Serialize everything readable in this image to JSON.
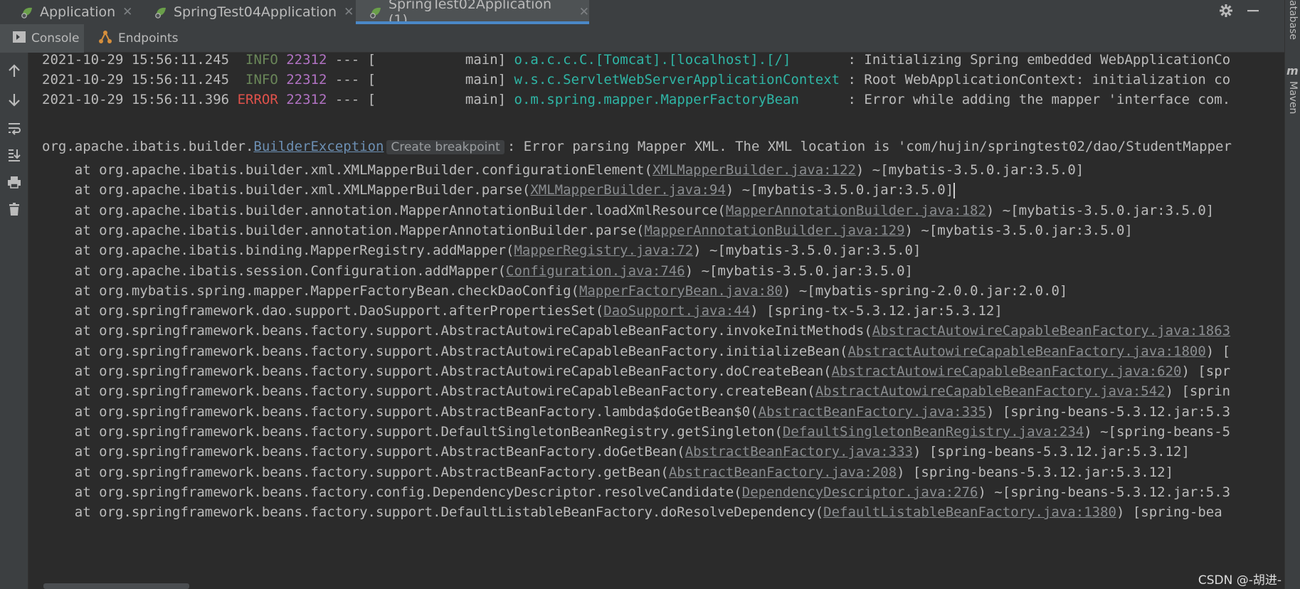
{
  "tabs": [
    {
      "label": "Application",
      "active": false
    },
    {
      "label": "SpringTest04Application",
      "active": false
    },
    {
      "label": "SpringTest02Application (1)",
      "active": true
    }
  ],
  "subtabs": [
    {
      "label": "Console",
      "active": true
    },
    {
      "label": "Endpoints",
      "active": false
    }
  ],
  "right_strip": {
    "top_label": "atabase",
    "maven_label": "Maven"
  },
  "log_header": [
    {
      "ts": "2021-10-29 15:56:11.245",
      "level": " INFO",
      "pid": "22312",
      "sep": " --- [",
      "thread": "           main]",
      "logger": "o.a.c.c.C.[Tomcat].[localhost].[/]      ",
      "msg": " : Initializing Spring embedded WebApplicationCo"
    },
    {
      "ts": "2021-10-29 15:56:11.245",
      "level": " INFO",
      "pid": "22312",
      "sep": " --- [",
      "thread": "           main]",
      "logger": "w.s.c.ServletWebServerApplicationContext",
      "msg": " : Root WebApplicationContext: initialization co"
    },
    {
      "ts": "2021-10-29 15:56:11.396",
      "level": "ERROR",
      "pid": "22312",
      "sep": " --- [",
      "thread": "           main]",
      "logger": "o.m.spring.mapper.MapperFactoryBean     ",
      "msg": " : Error while adding the mapper 'interface com."
    }
  ],
  "exception": {
    "prefix": "org.apache.ibatis.builder.",
    "class": "BuilderException",
    "hint": "Create breakpoint",
    "message": ": Error parsing Mapper XML. The XML location is 'com/hujin/springtest02/dao/StudentMapper"
  },
  "stack": [
    {
      "pre": "    at org.apache.ibatis.builder.xml.XMLMapperBuilder.configurationElement(",
      "link": "XMLMapperBuilder.java:122",
      "post": ") ~[mybatis-3.5.0.jar:3.5.0]"
    },
    {
      "pre": "    at org.apache.ibatis.builder.xml.XMLMapperBuilder.parse(",
      "link": "XMLMapperBuilder.java:94",
      "post": ") ~[mybatis-3.5.0.jar:3.5.0]"
    },
    {
      "pre": "    at org.apache.ibatis.builder.annotation.MapperAnnotationBuilder.loadXmlResource(",
      "link": "MapperAnnotationBuilder.java:182",
      "post": ") ~[mybatis-3.5.0.jar:3.5.0]"
    },
    {
      "pre": "    at org.apache.ibatis.builder.annotation.MapperAnnotationBuilder.parse(",
      "link": "MapperAnnotationBuilder.java:129",
      "post": ") ~[mybatis-3.5.0.jar:3.5.0]"
    },
    {
      "pre": "    at org.apache.ibatis.binding.MapperRegistry.addMapper(",
      "link": "MapperRegistry.java:72",
      "post": ") ~[mybatis-3.5.0.jar:3.5.0]"
    },
    {
      "pre": "    at org.apache.ibatis.session.Configuration.addMapper(",
      "link": "Configuration.java:746",
      "post": ") ~[mybatis-3.5.0.jar:3.5.0]"
    },
    {
      "pre": "    at org.mybatis.spring.mapper.MapperFactoryBean.checkDaoConfig(",
      "link": "MapperFactoryBean.java:80",
      "post": ") ~[mybatis-spring-2.0.0.jar:2.0.0]"
    },
    {
      "pre": "    at org.springframework.dao.support.DaoSupport.afterPropertiesSet(",
      "link": "DaoSupport.java:44",
      "post": ") [spring-tx-5.3.12.jar:5.3.12]"
    },
    {
      "pre": "    at org.springframework.beans.factory.support.AbstractAutowireCapableBeanFactory.invokeInitMethods(",
      "link": "AbstractAutowireCapableBeanFactory.java:1863",
      "post": ""
    },
    {
      "pre": "    at org.springframework.beans.factory.support.AbstractAutowireCapableBeanFactory.initializeBean(",
      "link": "AbstractAutowireCapableBeanFactory.java:1800",
      "post": ") ["
    },
    {
      "pre": "    at org.springframework.beans.factory.support.AbstractAutowireCapableBeanFactory.doCreateBean(",
      "link": "AbstractAutowireCapableBeanFactory.java:620",
      "post": ") [spr"
    },
    {
      "pre": "    at org.springframework.beans.factory.support.AbstractAutowireCapableBeanFactory.createBean(",
      "link": "AbstractAutowireCapableBeanFactory.java:542",
      "post": ") [sprin"
    },
    {
      "pre": "    at org.springframework.beans.factory.support.AbstractBeanFactory.lambda$doGetBean$0(",
      "link": "AbstractBeanFactory.java:335",
      "post": ") [spring-beans-5.3.12.jar:5.3"
    },
    {
      "pre": "    at org.springframework.beans.factory.support.DefaultSingletonBeanRegistry.getSingleton(",
      "link": "DefaultSingletonBeanRegistry.java:234",
      "post": ") ~[spring-beans-5"
    },
    {
      "pre": "    at org.springframework.beans.factory.support.AbstractBeanFactory.doGetBean(",
      "link": "AbstractBeanFactory.java:333",
      "post": ") [spring-beans-5.3.12.jar:5.3.12]"
    },
    {
      "pre": "    at org.springframework.beans.factory.support.AbstractBeanFactory.getBean(",
      "link": "AbstractBeanFactory.java:208",
      "post": ") [spring-beans-5.3.12.jar:5.3.12]"
    },
    {
      "pre": "    at org.springframework.beans.factory.config.DependencyDescriptor.resolveCandidate(",
      "link": "DependencyDescriptor.java:276",
      "post": ") ~[spring-beans-5.3.12.jar:5.3"
    },
    {
      "pre": "    at org.springframework.beans.factory.support.DefaultListableBeanFactory.doResolveDependency(",
      "link": "DefaultListableBeanFactory.java:1380",
      "post": ") [spring-bea"
    }
  ],
  "watermark": "CSDN @-胡进-",
  "colors": {
    "info": "#6a8759",
    "error": "#e0524b",
    "pid": "#b072c2",
    "logger": "#2fb5a5",
    "accent": "#4a88c7"
  },
  "icons": {
    "left_tools": [
      "arrow-up-icon",
      "arrow-down-icon",
      "soft-wrap-icon",
      "scroll-to-end-icon",
      "print-icon",
      "trash-icon"
    ],
    "tab_icon": "spring-run-icon",
    "top_right": [
      "gear-icon",
      "minimize-icon"
    ]
  }
}
